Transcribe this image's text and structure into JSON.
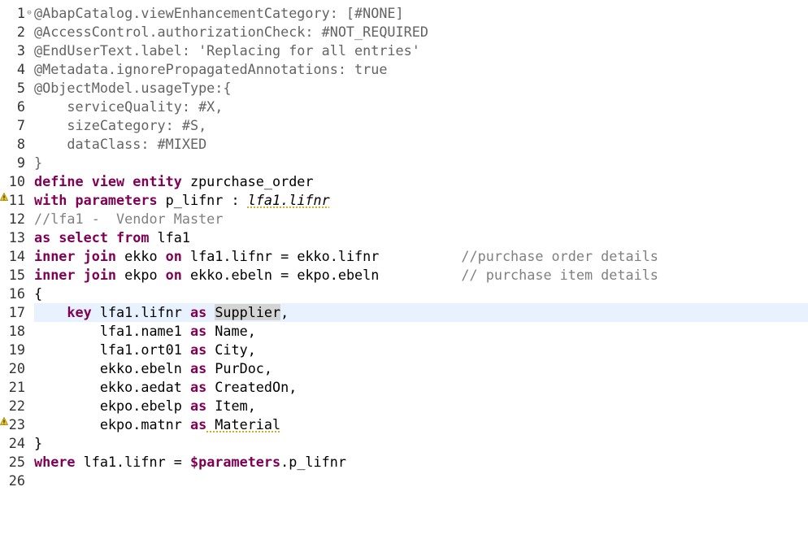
{
  "editor": {
    "line_numbers": [
      "1",
      "2",
      "3",
      "4",
      "5",
      "6",
      "7",
      "8",
      "9",
      "10",
      "11",
      "12",
      "13",
      "14",
      "15",
      "16",
      "17",
      "18",
      "19",
      "20",
      "21",
      "22",
      "23",
      "24",
      "25",
      "26"
    ],
    "fold_marker": "⊖",
    "current_line": 17,
    "warning_lines": [
      11,
      23
    ],
    "code": {
      "l1": {
        "ann": "@AbapCatalog.viewEnhancementCategory: [#NONE]"
      },
      "l2": {
        "ann": "@AccessControl.authorizationCheck: #NOT_REQUIRED"
      },
      "l3": {
        "ann": "@EndUserText.label: 'Replacing for all entries'"
      },
      "l4": {
        "ann": "@Metadata.ignorePropagatedAnnotations: true"
      },
      "l5": {
        "ann": "@ObjectModel.usageType:{"
      },
      "l6": {
        "ann": "    serviceQuality: #X,"
      },
      "l7": {
        "ann": "    sizeCategory: #S,"
      },
      "l8": {
        "ann": "    dataClass: #MIXED"
      },
      "l9": {
        "ann": "}"
      },
      "l10": {
        "kw": "define view entity",
        "rest": " zpurchase_order"
      },
      "l11": {
        "kw": "with parameters",
        "rest": " p_lifnr : ",
        "type": "lfa1.lifnr"
      },
      "l12": {
        "cmt": "//lfa1 -  Vendor Master"
      },
      "l13": {
        "kw": "as select from",
        "rest": " lfa1"
      },
      "l14": {
        "kw1": "inner join",
        "mid1": " ekko ",
        "kw2": "on",
        "rest": " lfa1.lifnr = ekko.lifnr",
        "pad": "          ",
        "cmt": "//purchase order details"
      },
      "l15": {
        "kw1": "inner join",
        "mid1": " ekpo ",
        "kw2": "on",
        "rest": " ekko.ebeln = ekpo.ebeln",
        "pad": "          ",
        "cmt": "// purchase item details"
      },
      "l16": {
        "text": "{"
      },
      "l17": {
        "indent": "    ",
        "kw": "key",
        "field": " lfa1.lifnr ",
        "as": "as",
        "sp": " ",
        "alias": "Supplier",
        "tail": ","
      },
      "l18": {
        "field": "        lfa1.name1 ",
        "as": "as",
        "alias": " Name,"
      },
      "l19": {
        "field": "        lfa1.ort01 ",
        "as": "as",
        "alias": " City,"
      },
      "l20": {
        "field": "        ekko.ebeln ",
        "as": "as",
        "alias": " PurDoc,"
      },
      "l21": {
        "field": "        ekko.aedat ",
        "as": "as",
        "alias": " CreatedOn,"
      },
      "l22": {
        "field": "        ekpo.ebelp ",
        "as": "as",
        "alias": " Item,"
      },
      "l23": {
        "field": "        ekpo.matnr ",
        "as": "as",
        "alias": " Material"
      },
      "l24": {
        "text": "}"
      },
      "l25": {
        "kw": "where",
        "rest": " lfa1.lifnr = ",
        "param": "$parameters",
        "tail": ".p_lifnr"
      },
      "l26": {
        "text": ""
      }
    }
  },
  "colors": {
    "keyword": "#7f0055",
    "annotation": "#646464",
    "string": "#2a00ff",
    "comment": "#808080",
    "current_line": "#e8f2fe"
  }
}
